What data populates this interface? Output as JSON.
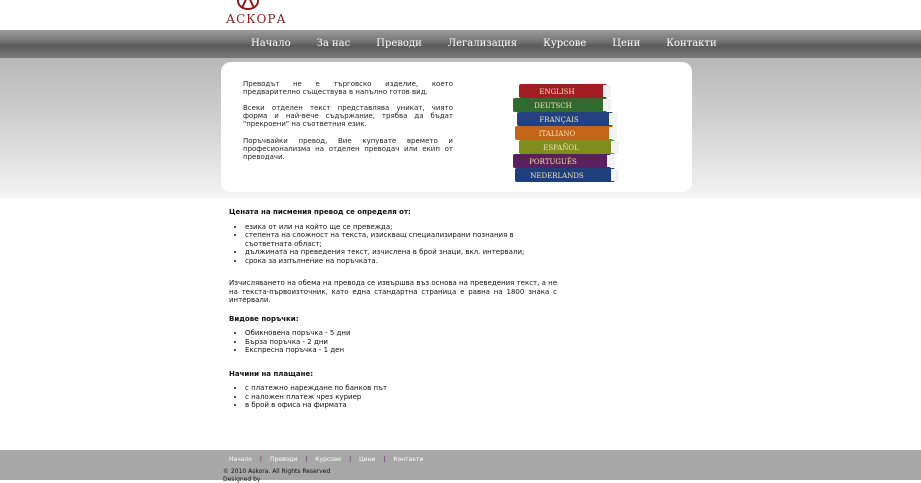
{
  "brand": {
    "logo_text": "АСКОРА"
  },
  "nav": [
    "Начало",
    "За нас",
    "Преводи",
    "Легализация",
    "Курсове",
    "Цени",
    "Контакти"
  ],
  "hero": {
    "paragraphs": [
      "Преводът не е търговско изделие, което предварително съществува в напълно готов вид.",
      "Всеки отделен текст представлява уникат, чиято форма и най-вече съдържание, трябва да бъдат \"прекроени\" на съответния език.",
      "Поръчвайки превод, Вие купувате времето и професионализма на отделен преводач или екип от преводачи."
    ],
    "book_labels": [
      "ENGLISH",
      "DEUTSCH",
      "FRANÇAIS",
      "ITALIANO",
      "ESPAÑOL",
      "PORTUGUÊS",
      "NEDERLANDS"
    ]
  },
  "content": {
    "price_heading": "Цената на писмения превод се определя от:",
    "price_factors": [
      "езика от или на който ще се превежда;",
      "степента на сложност на текста, изискващ специализирани познания в съответната област;",
      "дължината на преведения текст, изчислена в брой знаци, вкл. интервали;",
      "срока за изпълнение на поръчката."
    ],
    "volume_text": "Изчисляването на обема на превода се извършва въз основа на преведения текст, а не на текста-първоизточник, като една стандартна страница е равна на 1800 знака с интервали.",
    "orders_heading": "Видове поръчки:",
    "orders": [
      "Обикновена поръчка - 5 дни",
      "Бърза поръчка - 2 дни",
      "Експресна поръчка - 1 ден"
    ],
    "payment_heading": "Начини на плащане:",
    "payments": [
      "с платежно нареждане по банков път",
      "с наложен платеж чрез куриер",
      "в брой в офиса на фирмата"
    ]
  },
  "footer": {
    "links": [
      "Начало",
      "Преводи",
      "Курсове",
      "Цени",
      "Контакти"
    ],
    "separator": "|",
    "copyright": "© 2010 Askora. All Rights Reserved",
    "designed_by": "Designed by"
  },
  "colors": {
    "brand_red": "#8b1b1b",
    "footer_bg": "#a7a7a7",
    "nav_text": "#ffffff"
  }
}
